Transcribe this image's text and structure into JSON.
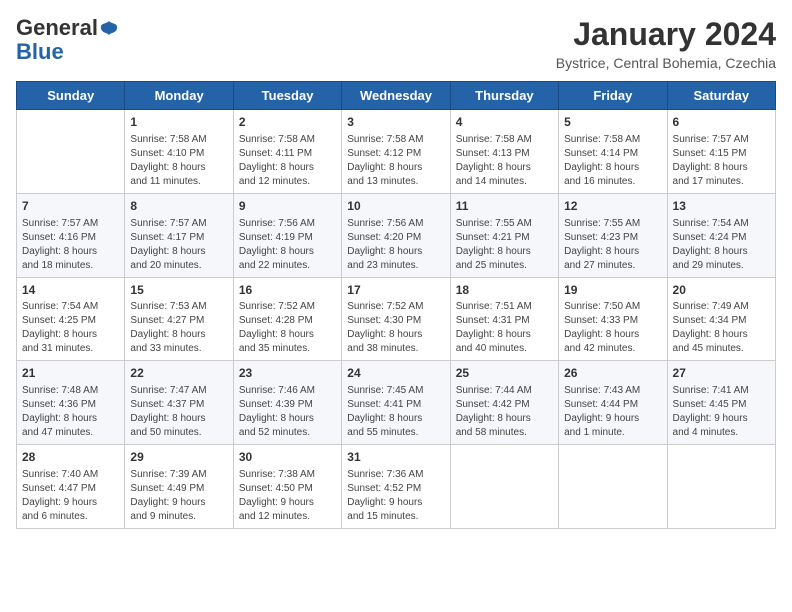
{
  "logo": {
    "general": "General",
    "blue": "Blue"
  },
  "title": "January 2024",
  "subtitle": "Bystrice, Central Bohemia, Czechia",
  "days_header": [
    "Sunday",
    "Monday",
    "Tuesday",
    "Wednesday",
    "Thursday",
    "Friday",
    "Saturday"
  ],
  "weeks": [
    [
      {
        "num": "",
        "info": ""
      },
      {
        "num": "1",
        "info": "Sunrise: 7:58 AM\nSunset: 4:10 PM\nDaylight: 8 hours\nand 11 minutes."
      },
      {
        "num": "2",
        "info": "Sunrise: 7:58 AM\nSunset: 4:11 PM\nDaylight: 8 hours\nand 12 minutes."
      },
      {
        "num": "3",
        "info": "Sunrise: 7:58 AM\nSunset: 4:12 PM\nDaylight: 8 hours\nand 13 minutes."
      },
      {
        "num": "4",
        "info": "Sunrise: 7:58 AM\nSunset: 4:13 PM\nDaylight: 8 hours\nand 14 minutes."
      },
      {
        "num": "5",
        "info": "Sunrise: 7:58 AM\nSunset: 4:14 PM\nDaylight: 8 hours\nand 16 minutes."
      },
      {
        "num": "6",
        "info": "Sunrise: 7:57 AM\nSunset: 4:15 PM\nDaylight: 8 hours\nand 17 minutes."
      }
    ],
    [
      {
        "num": "7",
        "info": "Sunrise: 7:57 AM\nSunset: 4:16 PM\nDaylight: 8 hours\nand 18 minutes."
      },
      {
        "num": "8",
        "info": "Sunrise: 7:57 AM\nSunset: 4:17 PM\nDaylight: 8 hours\nand 20 minutes."
      },
      {
        "num": "9",
        "info": "Sunrise: 7:56 AM\nSunset: 4:19 PM\nDaylight: 8 hours\nand 22 minutes."
      },
      {
        "num": "10",
        "info": "Sunrise: 7:56 AM\nSunset: 4:20 PM\nDaylight: 8 hours\nand 23 minutes."
      },
      {
        "num": "11",
        "info": "Sunrise: 7:55 AM\nSunset: 4:21 PM\nDaylight: 8 hours\nand 25 minutes."
      },
      {
        "num": "12",
        "info": "Sunrise: 7:55 AM\nSunset: 4:23 PM\nDaylight: 8 hours\nand 27 minutes."
      },
      {
        "num": "13",
        "info": "Sunrise: 7:54 AM\nSunset: 4:24 PM\nDaylight: 8 hours\nand 29 minutes."
      }
    ],
    [
      {
        "num": "14",
        "info": "Sunrise: 7:54 AM\nSunset: 4:25 PM\nDaylight: 8 hours\nand 31 minutes."
      },
      {
        "num": "15",
        "info": "Sunrise: 7:53 AM\nSunset: 4:27 PM\nDaylight: 8 hours\nand 33 minutes."
      },
      {
        "num": "16",
        "info": "Sunrise: 7:52 AM\nSunset: 4:28 PM\nDaylight: 8 hours\nand 35 minutes."
      },
      {
        "num": "17",
        "info": "Sunrise: 7:52 AM\nSunset: 4:30 PM\nDaylight: 8 hours\nand 38 minutes."
      },
      {
        "num": "18",
        "info": "Sunrise: 7:51 AM\nSunset: 4:31 PM\nDaylight: 8 hours\nand 40 minutes."
      },
      {
        "num": "19",
        "info": "Sunrise: 7:50 AM\nSunset: 4:33 PM\nDaylight: 8 hours\nand 42 minutes."
      },
      {
        "num": "20",
        "info": "Sunrise: 7:49 AM\nSunset: 4:34 PM\nDaylight: 8 hours\nand 45 minutes."
      }
    ],
    [
      {
        "num": "21",
        "info": "Sunrise: 7:48 AM\nSunset: 4:36 PM\nDaylight: 8 hours\nand 47 minutes."
      },
      {
        "num": "22",
        "info": "Sunrise: 7:47 AM\nSunset: 4:37 PM\nDaylight: 8 hours\nand 50 minutes."
      },
      {
        "num": "23",
        "info": "Sunrise: 7:46 AM\nSunset: 4:39 PM\nDaylight: 8 hours\nand 52 minutes."
      },
      {
        "num": "24",
        "info": "Sunrise: 7:45 AM\nSunset: 4:41 PM\nDaylight: 8 hours\nand 55 minutes."
      },
      {
        "num": "25",
        "info": "Sunrise: 7:44 AM\nSunset: 4:42 PM\nDaylight: 8 hours\nand 58 minutes."
      },
      {
        "num": "26",
        "info": "Sunrise: 7:43 AM\nSunset: 4:44 PM\nDaylight: 9 hours\nand 1 minute."
      },
      {
        "num": "27",
        "info": "Sunrise: 7:41 AM\nSunset: 4:45 PM\nDaylight: 9 hours\nand 4 minutes."
      }
    ],
    [
      {
        "num": "28",
        "info": "Sunrise: 7:40 AM\nSunset: 4:47 PM\nDaylight: 9 hours\nand 6 minutes."
      },
      {
        "num": "29",
        "info": "Sunrise: 7:39 AM\nSunset: 4:49 PM\nDaylight: 9 hours\nand 9 minutes."
      },
      {
        "num": "30",
        "info": "Sunrise: 7:38 AM\nSunset: 4:50 PM\nDaylight: 9 hours\nand 12 minutes."
      },
      {
        "num": "31",
        "info": "Sunrise: 7:36 AM\nSunset: 4:52 PM\nDaylight: 9 hours\nand 15 minutes."
      },
      {
        "num": "",
        "info": ""
      },
      {
        "num": "",
        "info": ""
      },
      {
        "num": "",
        "info": ""
      }
    ]
  ]
}
